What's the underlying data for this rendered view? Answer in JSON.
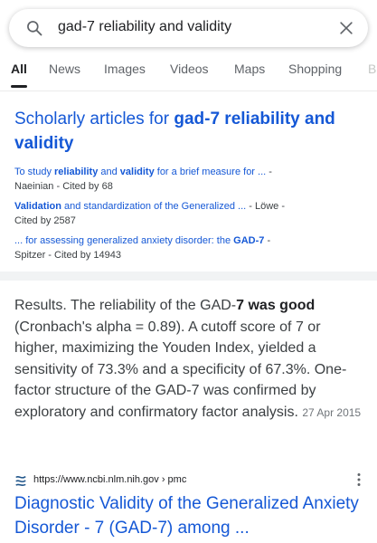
{
  "search": {
    "query": "gad-7 reliability and validity"
  },
  "tabs": [
    {
      "label": "All"
    },
    {
      "label": "News"
    },
    {
      "label": "Images"
    },
    {
      "label": "Videos"
    },
    {
      "label": "Maps"
    },
    {
      "label": "Shopping"
    },
    {
      "label": "B"
    }
  ],
  "scholar": {
    "title_prefix": "Scholarly articles for ",
    "title_query": "gad-7 reliability and validity",
    "items": [
      {
        "parts": [
          "To study ",
          "reliability",
          " and ",
          "validity",
          " for a brief measure for ... "
        ],
        "bold": [
          false,
          true,
          false,
          true,
          false
        ],
        "meta_line1": "- ",
        "meta_line2": "Naeinian - Cited by 68"
      },
      {
        "parts": [
          "Validation",
          " and standardization of the Generalized ... "
        ],
        "bold": [
          true,
          false
        ],
        "meta_line1": "- Löwe -",
        "meta_line2": "Cited by 2587"
      },
      {
        "parts": [
          "... for assessing generalized anxiety disorder: the ",
          "GAD-7",
          " "
        ],
        "bold": [
          false,
          true,
          false
        ],
        "meta_line1": "-",
        "meta_line2": "Spitzer - Cited by 14943"
      }
    ]
  },
  "snippet": {
    "p1": "Results. The reliability of the GAD-",
    "b1": "7 was good",
    "p2": " (Cronbach's alpha = 0.89). A cutoff score of 7 or higher, maximizing the Youden Index, yielded a sensitivity of 73.3% and a specificity of 67.3%. One-factor structure of the GAD-7 was confirmed by exploratory and confirmatory factor analysis.",
    "date": "27 Apr 2015"
  },
  "result": {
    "url": "https://www.ncbi.nlm.nih.gov › pmc",
    "title": "Diagnostic Validity of the Generalized Anxiety Disorder - 7 (GAD-7) among ..."
  },
  "colors": {
    "link": "#1558d6",
    "text": "#202124",
    "muted": "#5f6368"
  },
  "icons": {
    "search": "search-icon",
    "close": "close-icon",
    "favicon": "ncbi-favicon-icon",
    "menu": "more-vert-icon"
  }
}
